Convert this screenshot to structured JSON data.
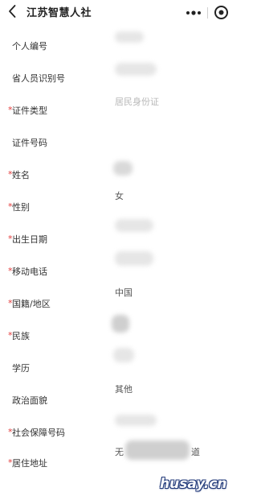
{
  "header": {
    "title": "江苏智慧人社"
  },
  "form": {
    "rows": [
      {
        "label": "个人编号",
        "required": false,
        "value": ""
      },
      {
        "label": "省人员识别号",
        "required": false,
        "value": ""
      },
      {
        "label": "证件类型",
        "required": true,
        "value": "居民身份证",
        "value_style": "placeholder"
      },
      {
        "label": "证件号码",
        "required": false,
        "value": ""
      },
      {
        "label": "姓名",
        "required": true,
        "value": ""
      },
      {
        "label": "性别",
        "required": true,
        "value": "女"
      },
      {
        "label": "出生日期",
        "required": true,
        "value": ""
      },
      {
        "label": "移动电话",
        "required": true,
        "value": ""
      },
      {
        "label": "国籍/地区",
        "required": true,
        "value": "中国"
      },
      {
        "label": "民族",
        "required": true,
        "value": ""
      },
      {
        "label": "学历",
        "required": false,
        "value": ""
      },
      {
        "label": "政治面貌",
        "required": false,
        "value": "其他"
      },
      {
        "label": "社会保障号码",
        "required": true,
        "value": ""
      },
      {
        "label": "居住地址",
        "required": true,
        "value": "无",
        "value_suffix": "道"
      }
    ],
    "required_marker": "*"
  },
  "watermark": {
    "text": "husay.cn"
  },
  "colors": {
    "required_marker": "#e33b3b",
    "label": "#333333",
    "placeholder": "#b8b8b8",
    "watermark_outline": "#223a7a"
  },
  "icons": {
    "back": "chevron-left-icon",
    "more": "more-dots-icon",
    "close": "target-icon"
  }
}
